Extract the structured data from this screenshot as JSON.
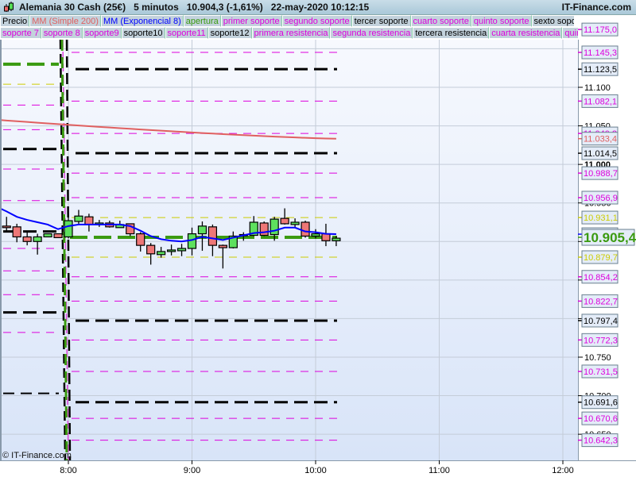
{
  "header": {
    "title": "Alemania 30 Cash (25€)   5 minutos   10.904,3 (-1,61%)   22-may-2020 10:12:15",
    "brand": "IT-Finance.com"
  },
  "legend_row1": [
    {
      "label": "Precio",
      "color": "#000000"
    },
    {
      "label": "MM (Simple 200)",
      "color": "#e06060"
    },
    {
      "label": "MM (Exponencial 8)",
      "color": "#0000ff"
    },
    {
      "label": "apertura",
      "color": "#3a9a10"
    },
    {
      "label": "primer soporte",
      "color": "#dd00dd"
    },
    {
      "label": "segundo soporte",
      "color": "#dd00dd"
    },
    {
      "label": "tercer soporte",
      "color": "#000000"
    },
    {
      "label": "cuarto soporte",
      "color": "#dd00dd"
    },
    {
      "label": "quinto soporte",
      "color": "#dd00dd"
    },
    {
      "label": "sexto soporte",
      "color": "#000000"
    }
  ],
  "legend_row2": [
    {
      "label": "soporte 7",
      "color": "#dd00dd"
    },
    {
      "label": "soporte 8",
      "color": "#dd00dd"
    },
    {
      "label": "soporte9",
      "color": "#dd00dd"
    },
    {
      "label": "soporte10",
      "color": "#000000"
    },
    {
      "label": "soporte11",
      "color": "#dd00dd"
    },
    {
      "label": "soporte12",
      "color": "#000000"
    },
    {
      "label": "primera resistencia",
      "color": "#dd00dd"
    },
    {
      "label": "segunda resistencia",
      "color": "#dd00dd"
    },
    {
      "label": "tercera resistencia",
      "color": "#000000"
    },
    {
      "label": "cuarta resistencia",
      "color": "#dd00dd"
    },
    {
      "label": "quinta",
      "color": "#dd00dd"
    }
  ],
  "copyright": "© IT-Finance.com",
  "chart_data": {
    "type": "candlestick",
    "title": "Alemania 30 Cash (25€) 5 minutos",
    "interval_minutes": 5,
    "first_candle_time": "7:30",
    "ylim": [
      10625,
      11200
    ],
    "xlim": [
      "7:27",
      "12:05"
    ],
    "y_ticks": [
      "11.100",
      "11.050",
      "11.000",
      "10.950",
      "10.900",
      "10.850",
      "10.800",
      "10.750",
      "10.700",
      "10.650"
    ],
    "y_tick_values": [
      11100,
      11050,
      11000,
      10950,
      10900,
      10850,
      10800,
      10750,
      10700,
      10650
    ],
    "x_ticks": [
      "8:00",
      "9:00",
      "10:00",
      "11:00",
      "12:00"
    ],
    "x_tick_minutes": [
      0,
      60,
      120,
      180,
      240
    ],
    "candles": [
      [
        10920,
        10932,
        10913,
        10918
      ],
      [
        10919,
        10923,
        10899,
        10906
      ],
      [
        10906,
        10912,
        10895,
        10900
      ],
      [
        10900,
        10910,
        10883,
        10906
      ],
      [
        10906,
        10910,
        10906,
        10910
      ],
      [
        10910,
        10910,
        10905,
        10905
      ],
      [
        10906,
        10932,
        10904,
        10927
      ],
      [
        10926,
        10941,
        10923,
        10933
      ],
      [
        10932,
        10936,
        10913,
        10922
      ],
      [
        10922,
        10928,
        10919,
        10924
      ],
      [
        10924,
        10927,
        10918,
        10919
      ],
      [
        10918,
        10927,
        10918,
        10922
      ],
      [
        10923,
        10923,
        10907,
        10910
      ],
      [
        10910,
        10912,
        10887,
        10895
      ],
      [
        10895,
        10898,
        10870,
        10884
      ],
      [
        10883,
        10893,
        10879,
        10887
      ],
      [
        10887,
        10896,
        10882,
        10889
      ],
      [
        10888,
        10897,
        10881,
        10891
      ],
      [
        10891,
        10918,
        10882,
        10910
      ],
      [
        10910,
        10926,
        10888,
        10920
      ],
      [
        10919,
        10922,
        10881,
        10895
      ],
      [
        10895,
        10896,
        10865,
        10892
      ],
      [
        10892,
        10913,
        10891,
        10907
      ],
      [
        10909,
        10912,
        10901,
        10909
      ],
      [
        10908,
        10933,
        10907,
        10925
      ],
      [
        10924,
        10926,
        10907,
        10908
      ],
      [
        10909,
        10932,
        10901,
        10929
      ],
      [
        10930,
        10943,
        10922,
        10923
      ],
      [
        10922,
        10930,
        10918,
        10925
      ],
      [
        10925,
        10927,
        10905,
        10907
      ],
      [
        10907,
        10916,
        10904,
        10910
      ],
      [
        10910,
        10923,
        10894,
        10901
      ],
      [
        10901,
        10907,
        10894,
        10904.3
      ]
    ],
    "ema8": [
      10939,
      10932,
      10928,
      10925,
      10922,
      10916,
      10920,
      10922,
      10922,
      10922,
      10922,
      10922,
      10920,
      10914,
      10907,
      10903,
      10901,
      10900,
      10902,
      10906,
      10904,
      10902,
      10905,
      10908,
      10911,
      10912,
      10914,
      10918,
      10918,
      10913,
      10912,
      10910,
      10909.5
    ],
    "sma200": {
      "start_minutes": -90,
      "start": 11069,
      "end": 11033.4
    },
    "previous_day_levels": [
      {
        "value": 11130,
        "color": "#3a9a10",
        "style": "apertura"
      },
      {
        "value": 11104,
        "color": "#cccc00",
        "style": "thin"
      },
      {
        "value": 11077,
        "color": "#dd00dd",
        "style": "thin"
      },
      {
        "value": 11045,
        "color": "#dd00dd",
        "style": "thin"
      },
      {
        "value": 11020,
        "color": "#000000",
        "style": "thick"
      },
      {
        "value": 10994,
        "color": "#dd00dd",
        "style": "thin"
      },
      {
        "value": 10953,
        "color": "#dd00dd",
        "style": "thin"
      },
      {
        "value": 10913,
        "color": "#000000",
        "style": "thick"
      },
      {
        "value": 10891,
        "color": "#dd00dd",
        "style": "thin"
      },
      {
        "value": 10862,
        "color": "#dd00dd",
        "style": "thin"
      },
      {
        "value": 10831,
        "color": "#dd00dd",
        "style": "thin"
      },
      {
        "value": 10808,
        "color": "#000000",
        "style": "thick"
      },
      {
        "value": 10782,
        "color": "#dd00dd",
        "style": "thin"
      },
      {
        "value": 10703,
        "color": "#000000",
        "style": "medium"
      }
    ],
    "levels": [
      {
        "value": 11175.0,
        "label": "11.175,0",
        "color": "#dd00dd",
        "style": "none"
      },
      {
        "value": 11145.3,
        "label": "11.145,3",
        "color": "#dd00dd",
        "style": "thin"
      },
      {
        "value": 11123.5,
        "label": "11.123,5",
        "color": "#000000",
        "style": "thick"
      },
      {
        "value": 11082.1,
        "label": "11.082,1",
        "color": "#dd00dd",
        "style": "thin"
      },
      {
        "value": 11040.2,
        "label": "11.040,2",
        "color": "#dd00dd",
        "style": "thin"
      },
      {
        "value": 11033.4,
        "label": "11.033,4",
        "color": "#e06060",
        "style": "none"
      },
      {
        "value": 11014.5,
        "label": "11.014,5",
        "color": "#000000",
        "style": "thick"
      },
      {
        "value": 10988.7,
        "label": "10.988,7",
        "color": "#dd00dd",
        "style": "thin"
      },
      {
        "value": 10956.9,
        "label": "10.956,9",
        "color": "#dd00dd",
        "style": "thin"
      },
      {
        "value": 10931.1,
        "label": "10.931,1",
        "color": "#cccc00",
        "style": "thin"
      },
      {
        "value": 10909.5,
        "label": "10.909,5",
        "color": "#0000ff",
        "style": "none"
      },
      {
        "value": 10879.7,
        "label": "10.879,7",
        "color": "#cccc00",
        "style": "thin"
      },
      {
        "value": 10854.2,
        "label": "10.854,2",
        "color": "#dd00dd",
        "style": "thin"
      },
      {
        "value": 10822.7,
        "label": "10.822,7",
        "color": "#dd00dd",
        "style": "thin"
      },
      {
        "value": 10797.4,
        "label": "10.797,4",
        "color": "#000000",
        "style": "thick"
      },
      {
        "value": 10772.3,
        "label": "10.772,3",
        "color": "#dd00dd",
        "style": "thin"
      },
      {
        "value": 10731.5,
        "label": "10.731,5",
        "color": "#dd00dd",
        "style": "thin"
      },
      {
        "value": 10691.6,
        "label": "10.691,6",
        "color": "#000000",
        "style": "thick"
      },
      {
        "value": 10670.6,
        "label": "10.670,6",
        "color": "#dd00dd",
        "style": "thin"
      },
      {
        "value": 10642.3,
        "label": "10.642,3",
        "color": "#dd00dd",
        "style": "thin"
      }
    ],
    "apertura": {
      "value": 10905.4,
      "label": "10.905,4",
      "color": "#3a9a10"
    },
    "colors": {
      "up": "#5ee05e",
      "down": "#ee7777",
      "ema": "#0000ff",
      "sma": "#e06060"
    }
  }
}
